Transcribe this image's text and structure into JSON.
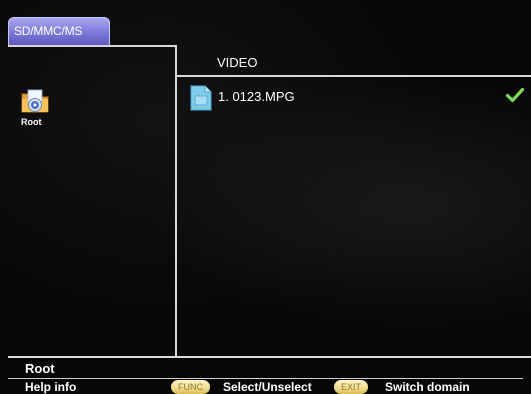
{
  "header": {
    "tab_label": "SD/MMC/MS"
  },
  "tree": {
    "root_label": "Root",
    "root_icon": "folder-disc-icon"
  },
  "content": {
    "section_title": "VIDEO",
    "files": [
      {
        "label": "1. 0123.MPG",
        "icon": "video-file-icon",
        "selected": true
      }
    ]
  },
  "status": {
    "current_path": "Root"
  },
  "help": {
    "label": "Help info",
    "func_key": "FUNC",
    "func_action": "Select/Unselect",
    "exit_key": "EXIT",
    "exit_action": "Switch domain"
  },
  "colors": {
    "tab_fill": "#7c78d8",
    "file_icon": "#7ecbea",
    "check": "#7ed957",
    "key_pill": "#f2dc8a"
  }
}
